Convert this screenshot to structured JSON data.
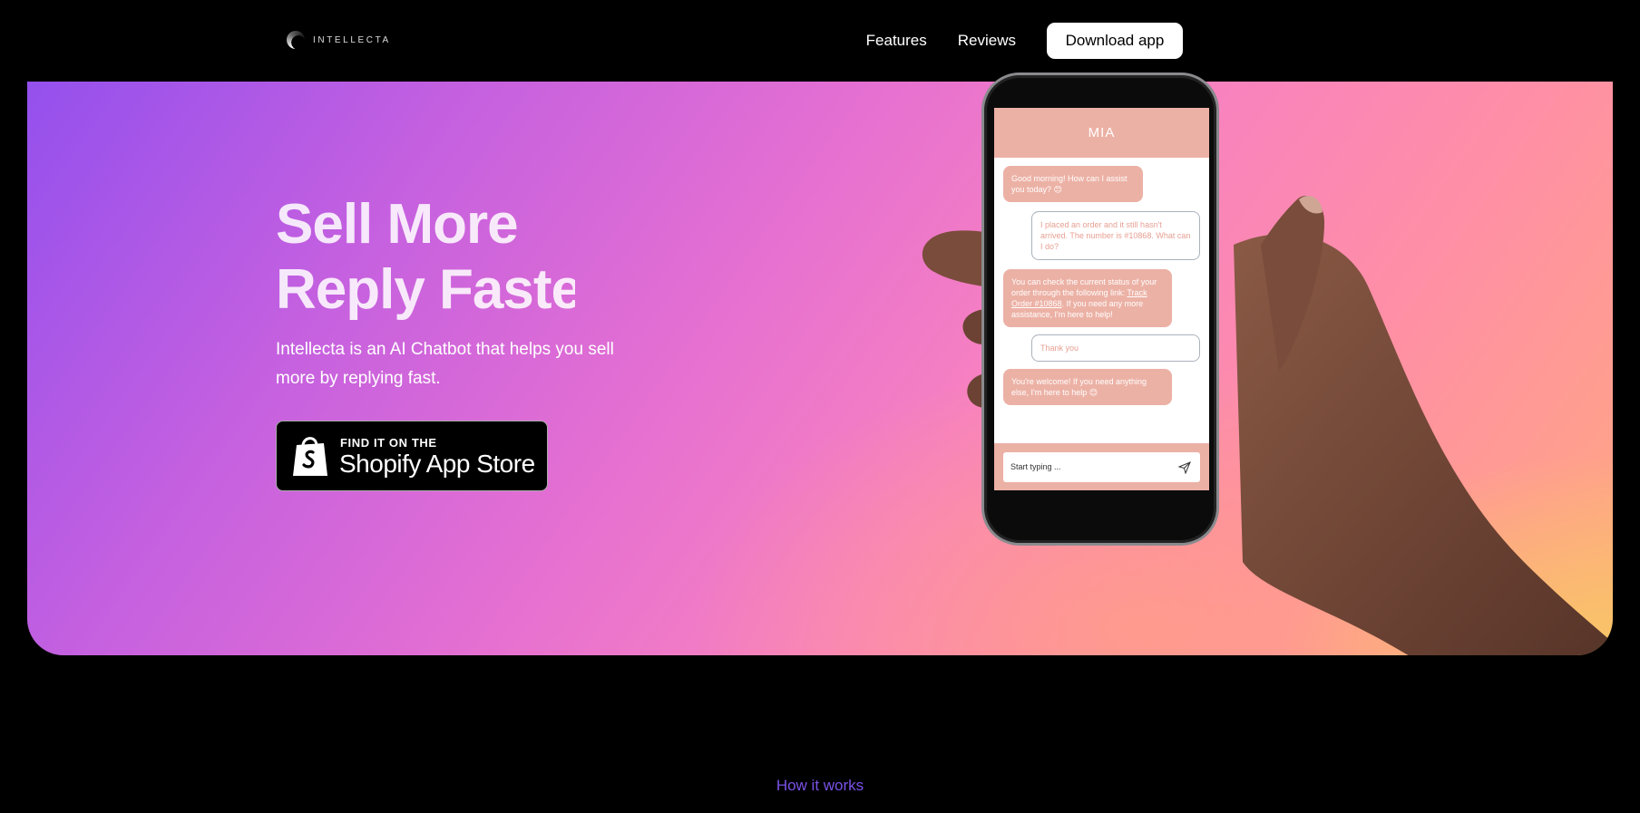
{
  "header": {
    "logo_text": "INTELLECTA",
    "nav": {
      "features": "Features",
      "reviews": "Reviews"
    },
    "download_label": "Download app"
  },
  "hero": {
    "headline_line1": "Sell More",
    "headline_line2": "Reply Faster",
    "subtitle": "Intellecta is an AI Chatbot that helps you sell more by replying fast.",
    "badge_small": "FIND IT ON THE",
    "badge_big": "Shopify App Store"
  },
  "chat": {
    "title": "MIA",
    "messages": [
      {
        "from": "bot",
        "text": "Good morning! How can I assist you today? 😊"
      },
      {
        "from": "user",
        "text": "I placed an order and it still hasn't arrived. The number is #10868. What can I do?"
      },
      {
        "from": "bot",
        "text_before": "You can check the current status of your order through the following link: ",
        "link": "Track Order #10868",
        "text_after": ". If you need any more assistance, I'm here to help!"
      },
      {
        "from": "user",
        "text": "Thank you"
      },
      {
        "from": "bot",
        "text": "You're welcome! If you need anything else, I'm here to help 😊"
      }
    ],
    "input_placeholder": "Start typing ..."
  },
  "section": {
    "how_it_works": "How it works"
  },
  "colors": {
    "chat_accent": "#ecb1a5",
    "how_it_works": "#7a52e8",
    "gradient_start": "#9450ed",
    "gradient_mid": "#f882bf",
    "gradient_end": "#f8c864"
  }
}
